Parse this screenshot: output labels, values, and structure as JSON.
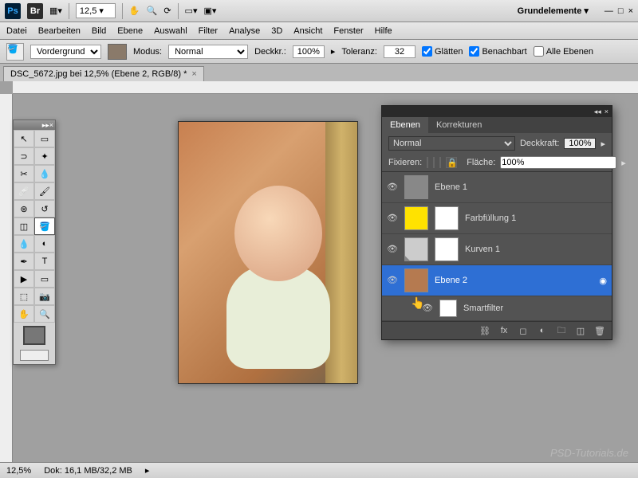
{
  "topbar": {
    "zoom": "12,5",
    "workspace": "Grundelemente ▾"
  },
  "menubar": [
    "Datei",
    "Bearbeiten",
    "Bild",
    "Ebene",
    "Auswahl",
    "Filter",
    "Analyse",
    "3D",
    "Ansicht",
    "Fenster",
    "Hilfe"
  ],
  "options": {
    "fill_target_label": "Vordergrund",
    "mode_label": "Modus:",
    "mode_value": "Normal",
    "opacity_label": "Deckkr.:",
    "opacity_value": "100%",
    "tolerance_label": "Toleranz:",
    "tolerance_value": "32",
    "antialias": "Glätten",
    "contiguous": "Benachbart",
    "all_layers": "Alle Ebenen"
  },
  "doctab": {
    "title": "DSC_5672.jpg bei 12,5% (Ebene 2, RGB/8) *",
    "close": "×"
  },
  "layers_panel": {
    "tabs": [
      "Ebenen",
      "Korrekturen"
    ],
    "blend_mode": "Normal",
    "opacity_label": "Deckkraft:",
    "opacity_value": "100%",
    "lock_label": "Fixieren:",
    "fill_label": "Fläche:",
    "fill_value": "100%",
    "layers": [
      {
        "name": "Ebene 1",
        "thumb_bg": "#888888"
      },
      {
        "name": "Farbfüllung 1",
        "thumb_bg": "#ffe200",
        "has_mask": true
      },
      {
        "name": "Kurven 1",
        "thumb_bg": "#cccccc",
        "has_mask": true
      },
      {
        "name": "Ebene 2",
        "thumb_bg": "#b57a50",
        "selected": true,
        "smart": true
      },
      {
        "name": "Smartfilter",
        "is_sub": true
      }
    ]
  },
  "statusbar": {
    "zoom": "12,5%",
    "doc": "Dok: 16,1 MB/32,2 MB"
  },
  "watermark": "PSD-Tutorials.de"
}
